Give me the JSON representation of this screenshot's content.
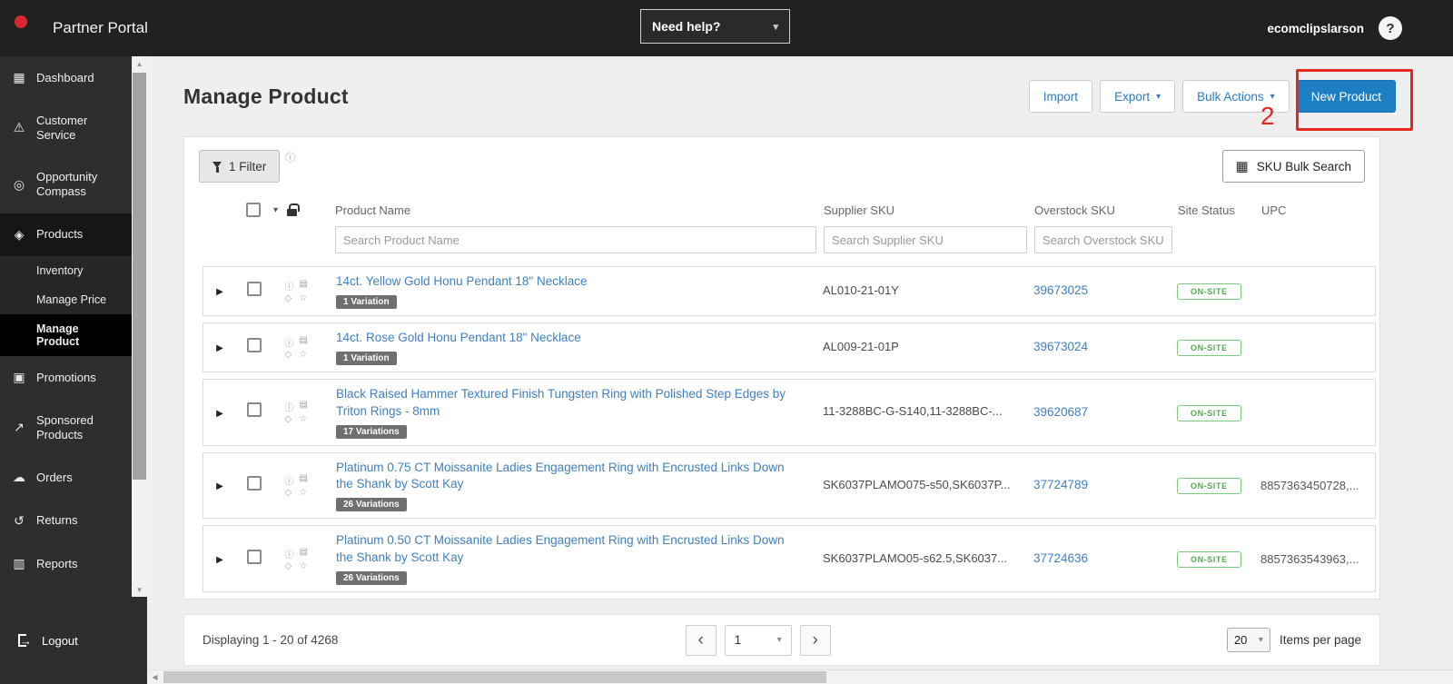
{
  "colors": {
    "brand_red": "#d7282f",
    "accent_blue": "#1e7ec2",
    "link_blue": "#4080bf",
    "success_green": "#56aa56",
    "annotation_red": "#e8261d"
  },
  "icons": {
    "dashboard": "▦",
    "customer_service": "⚠",
    "opportunity_compass": "◎",
    "products": "◈",
    "promotions": "▣",
    "sponsored_products": "↗",
    "orders": "☁",
    "returns": "↺",
    "reports": "▥",
    "logout_arrow": "→",
    "expander": "▶",
    "caret_down": "▾",
    "chevron_left": "‹",
    "chevron_right": "›",
    "info": "ⓘ",
    "image": "▤",
    "tag": "◇",
    "star": "☆",
    "grid": "▦",
    "scroll_up": "▲",
    "scroll_down": "▼",
    "scroll_left": "◀"
  },
  "topbar": {
    "brand": "Partner Portal",
    "need_help": "Need help?",
    "username": "ecomclipslarson",
    "help_glyph": "?"
  },
  "sidebar": {
    "items": [
      {
        "label": "Dashboard"
      },
      {
        "label": "Customer Service"
      },
      {
        "label": "Opportunity Compass"
      },
      {
        "label": "Products"
      },
      {
        "label": "Promotions"
      },
      {
        "label": "Sponsored Products"
      },
      {
        "label": "Orders"
      },
      {
        "label": "Returns"
      },
      {
        "label": "Reports"
      }
    ],
    "products_subitems": [
      {
        "label": "Inventory"
      },
      {
        "label": "Manage Price"
      },
      {
        "label": "Manage Product"
      }
    ],
    "logout": "Logout"
  },
  "header": {
    "title": "Manage Product",
    "buttons": {
      "import": "Import",
      "export": "Export",
      "bulk_actions": "Bulk Actions",
      "new_product": "New Product"
    },
    "annotation": "2"
  },
  "toolbar": {
    "filter": "1 Filter",
    "sku_bulk_search": "SKU Bulk Search"
  },
  "table": {
    "headers": {
      "product_name": "Product Name",
      "supplier_sku": "Supplier SKU",
      "overstock_sku": "Overstock SKU",
      "site_status": "Site Status",
      "upc": "UPC"
    },
    "search": {
      "product_name": "Search Product Name",
      "supplier_sku": "Search Supplier SKU",
      "overstock_sku": "Search Overstock SKU"
    },
    "rows": [
      {
        "name": "14ct. Yellow Gold Honu Pendant 18\" Necklace",
        "variations": "1 Variation",
        "supplier_sku": "AL010-21-01Y",
        "overstock_sku": "39673025",
        "site_status": "ON-SITE",
        "upc": ""
      },
      {
        "name": "14ct. Rose Gold Honu Pendant 18\" Necklace",
        "variations": "1 Variation",
        "supplier_sku": "AL009-21-01P",
        "overstock_sku": "39673024",
        "site_status": "ON-SITE",
        "upc": ""
      },
      {
        "name": "Black Raised Hammer Textured Finish Tungsten Ring with Polished Step Edges by Triton Rings - 8mm",
        "variations": "17 Variations",
        "supplier_sku": "11-3288BC-G-S140,11-3288BC-...",
        "overstock_sku": "39620687",
        "site_status": "ON-SITE",
        "upc": ""
      },
      {
        "name": "Platinum 0.75 CT Moissanite Ladies Engagement Ring with Encrusted Links Down the Shank by Scott Kay",
        "variations": "26 Variations",
        "supplier_sku": "SK6037PLAMO075-s50,SK6037P...",
        "overstock_sku": "37724789",
        "site_status": "ON-SITE",
        "upc": "8857363450728,..."
      },
      {
        "name": "Platinum 0.50 CT Moissanite Ladies Engagement Ring with Encrusted Links Down the Shank by Scott Kay",
        "variations": "26 Variations",
        "supplier_sku": "SK6037PLAMO05-s62.5,SK6037...",
        "overstock_sku": "37724636",
        "site_status": "ON-SITE",
        "upc": "8857363543963,..."
      }
    ]
  },
  "footer": {
    "displaying": "Displaying 1 - 20 of 4268",
    "page": "1",
    "per_page": "20",
    "per_page_label": "Items per page"
  }
}
